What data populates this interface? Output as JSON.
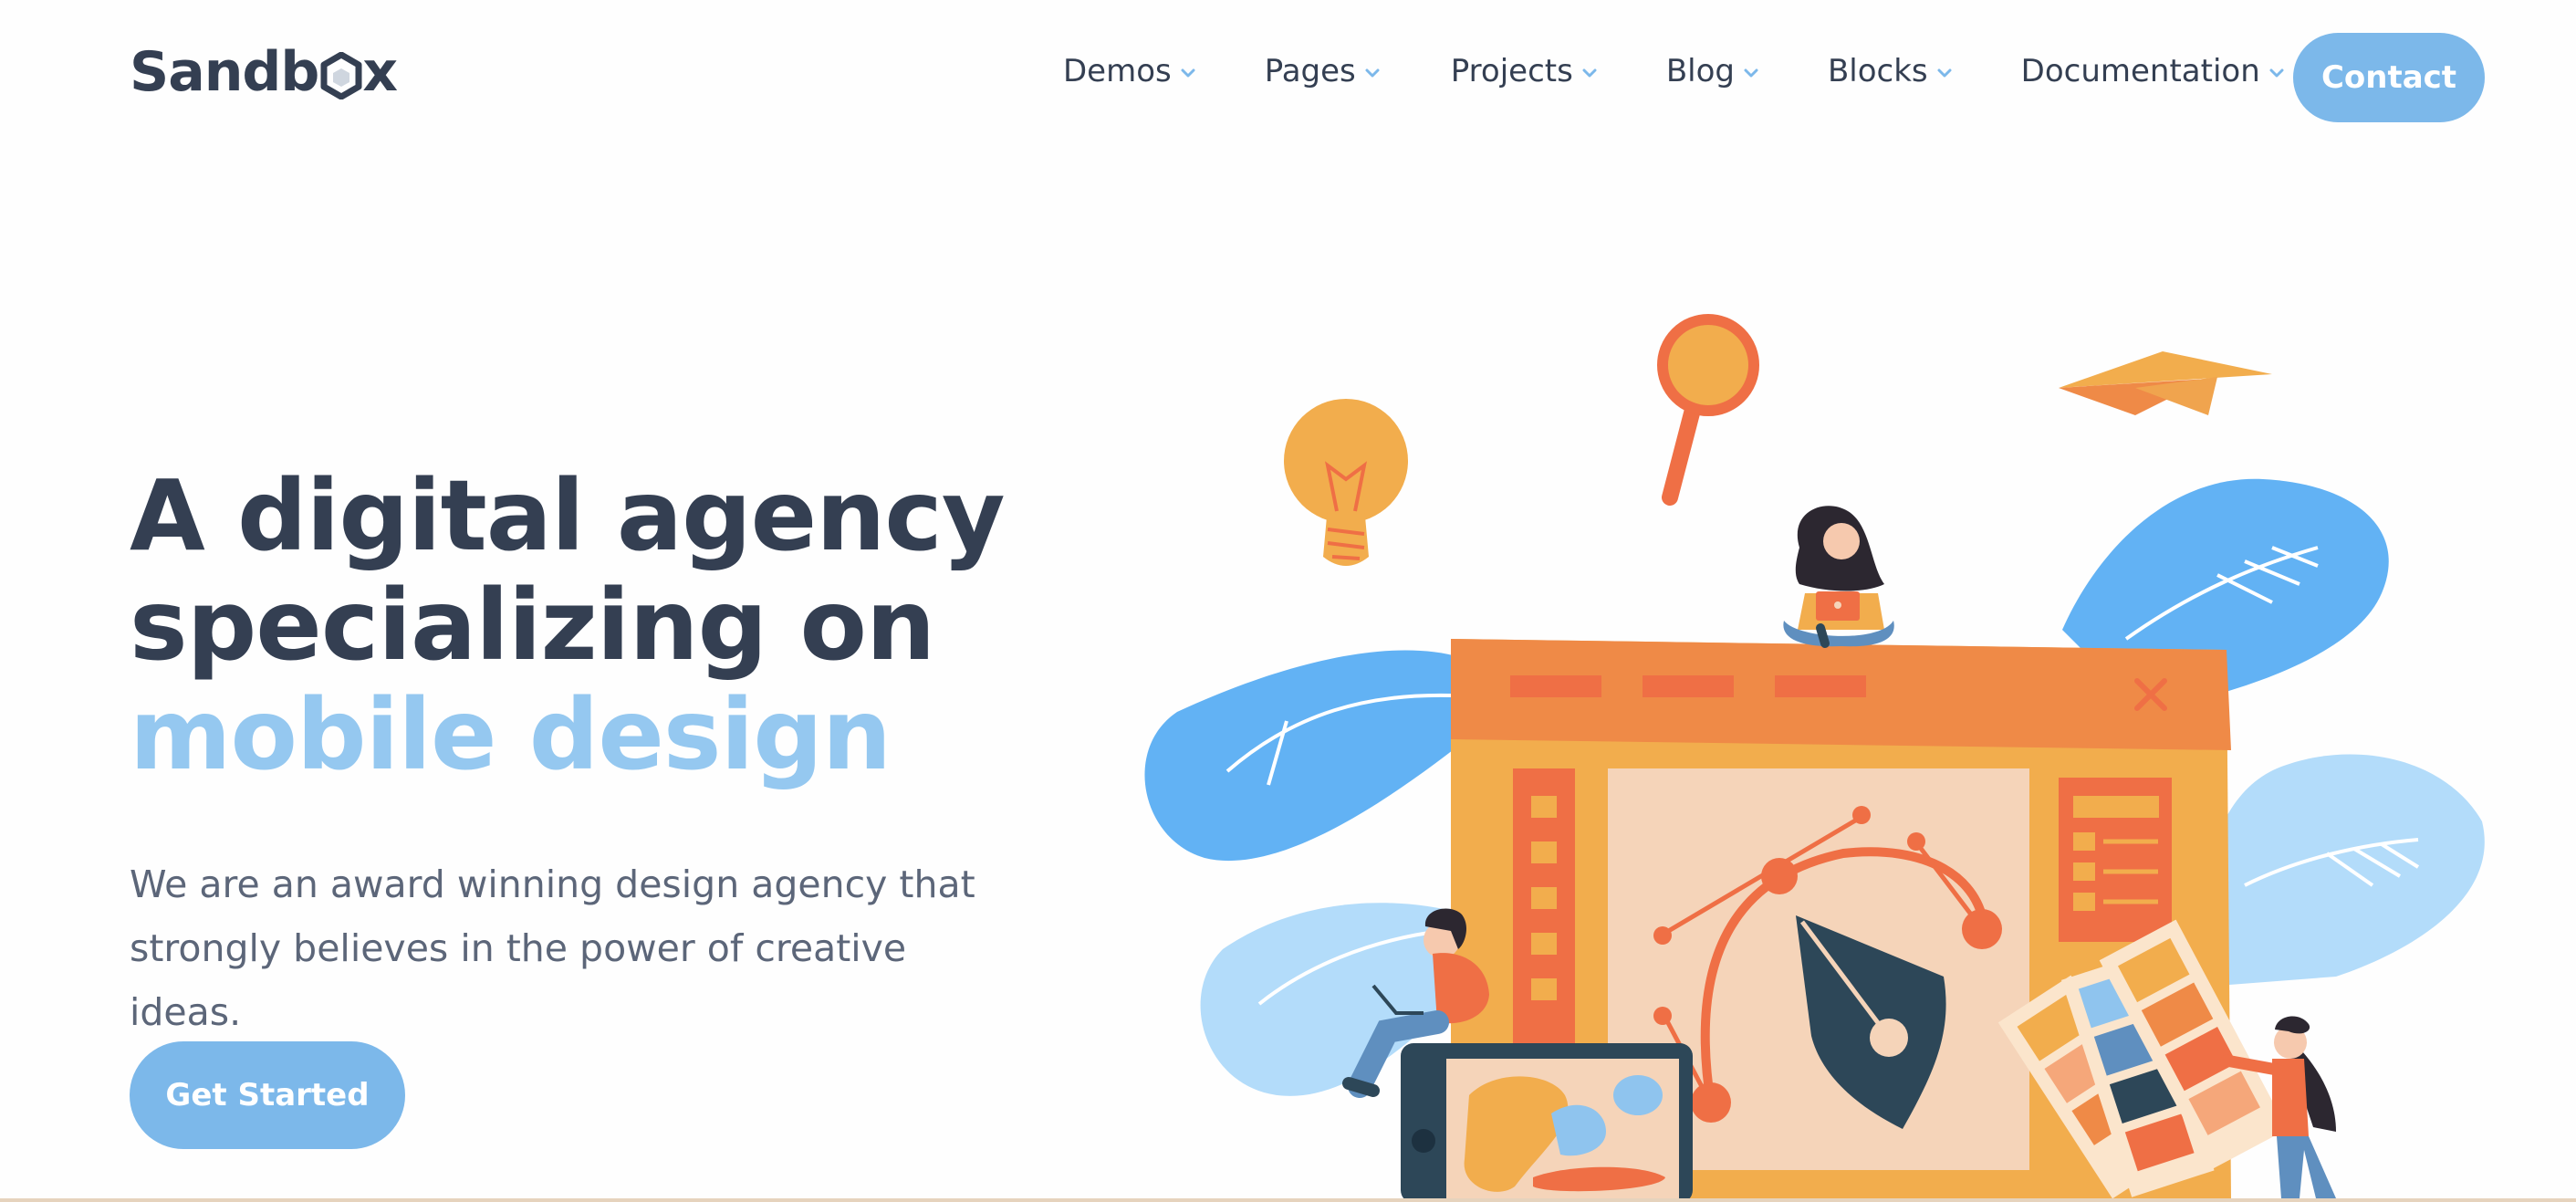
{
  "header": {
    "logo_pre": "Sandb",
    "logo_post": "x",
    "nav": [
      {
        "label": "Demos"
      },
      {
        "label": "Pages"
      },
      {
        "label": "Projects"
      },
      {
        "label": "Blog"
      },
      {
        "label": "Blocks"
      },
      {
        "label": "Documentation"
      }
    ],
    "contact_label": "Contact"
  },
  "hero": {
    "title_line1": "A digital agency",
    "title_line2": "specializing on",
    "title_highlight": "mobile design",
    "description": "We are an award winning design agency that strongly believes in the power of creative ideas.",
    "cta_label": "Get Started"
  },
  "colors": {
    "accent": "#7cb8ea",
    "highlight": "#95c8f0",
    "heading": "#343f52",
    "text": "#5c6679",
    "orange": "#ef8a47",
    "yellow": "#f2ad4d",
    "blue": "#62b2f4",
    "light_blue": "#b3dcfa",
    "navy": "#2d4758"
  },
  "icons": {
    "chevron": "chevron-down-icon",
    "logo_mark": "hexagon-box-icon"
  }
}
